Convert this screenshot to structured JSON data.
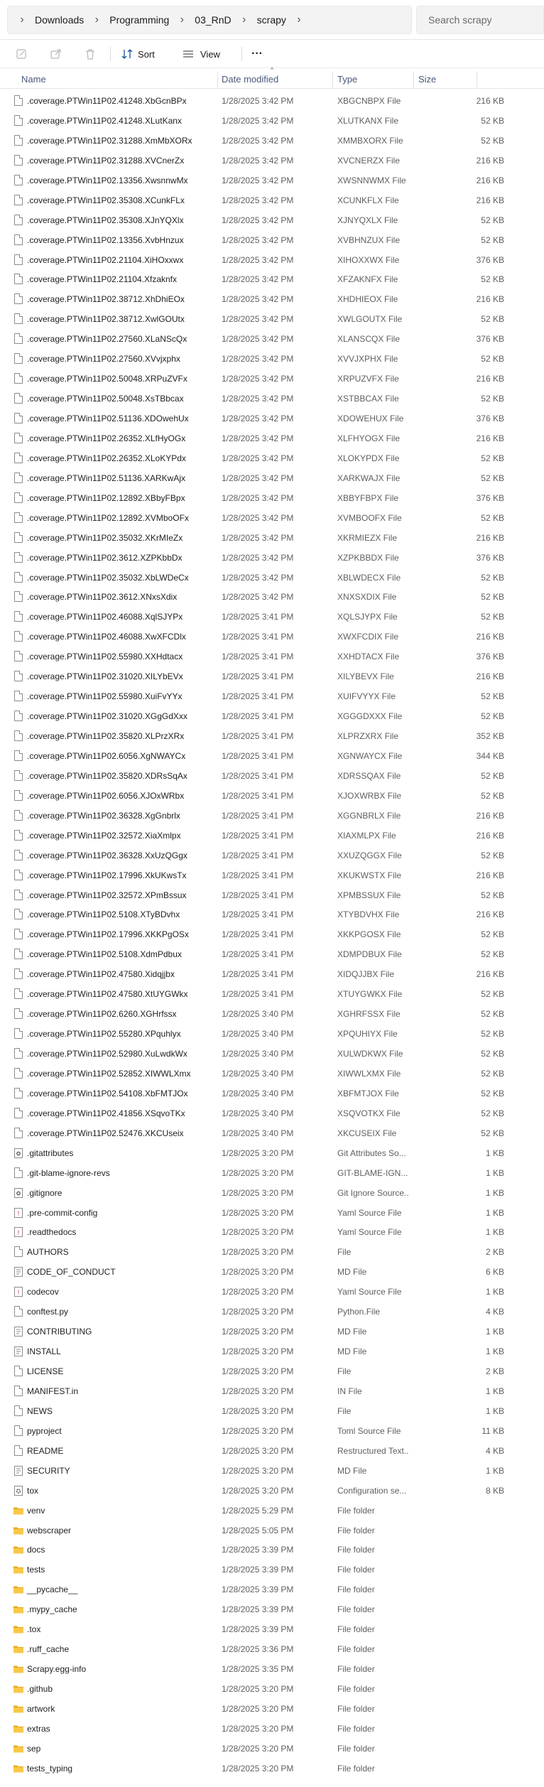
{
  "address": {
    "crumbs": [
      "Downloads",
      "Programming",
      "03_RnD",
      "scrapy"
    ],
    "search_placeholder": "Search scrapy"
  },
  "toolbar": {
    "sort_label": "Sort",
    "view_label": "View",
    "more_label": "···"
  },
  "columns": {
    "name": "Name",
    "date": "Date modified",
    "type": "Type",
    "size": "Size"
  },
  "files": [
    {
      "name": ".coverage.PTWin11P02.41248.XbGcnBPx",
      "date": "1/28/2025 3:42 PM",
      "type": "XBGCNBPX File",
      "size": "216 KB",
      "icon": "file"
    },
    {
      "name": ".coverage.PTWin11P02.41248.XLutKanx",
      "date": "1/28/2025 3:42 PM",
      "type": "XLUTKANX File",
      "size": "52 KB",
      "icon": "file"
    },
    {
      "name": ".coverage.PTWin11P02.31288.XmMbXORx",
      "date": "1/28/2025 3:42 PM",
      "type": "XMMBXORX File",
      "size": "52 KB",
      "icon": "file"
    },
    {
      "name": ".coverage.PTWin11P02.31288.XVCnerZx",
      "date": "1/28/2025 3:42 PM",
      "type": "XVCNERZX File",
      "size": "216 KB",
      "icon": "file"
    },
    {
      "name": ".coverage.PTWin11P02.13356.XwsnnwMx",
      "date": "1/28/2025 3:42 PM",
      "type": "XWSNNWMX File",
      "size": "216 KB",
      "icon": "file"
    },
    {
      "name": ".coverage.PTWin11P02.35308.XCunkFLx",
      "date": "1/28/2025 3:42 PM",
      "type": "XCUNKFLX File",
      "size": "216 KB",
      "icon": "file"
    },
    {
      "name": ".coverage.PTWin11P02.35308.XJnYQXlx",
      "date": "1/28/2025 3:42 PM",
      "type": "XJNYQXLX File",
      "size": "52 KB",
      "icon": "file"
    },
    {
      "name": ".coverage.PTWin11P02.13356.XvbHnzux",
      "date": "1/28/2025 3:42 PM",
      "type": "XVBHNZUX File",
      "size": "52 KB",
      "icon": "file"
    },
    {
      "name": ".coverage.PTWin11P02.21104.XiHOxxwx",
      "date": "1/28/2025 3:42 PM",
      "type": "XIHOXXWX File",
      "size": "376 KB",
      "icon": "file"
    },
    {
      "name": ".coverage.PTWin11P02.21104.Xfzaknfx",
      "date": "1/28/2025 3:42 PM",
      "type": "XFZAKNFX File",
      "size": "52 KB",
      "icon": "file"
    },
    {
      "name": ".coverage.PTWin11P02.38712.XhDhiEOx",
      "date": "1/28/2025 3:42 PM",
      "type": "XHDHIEOX File",
      "size": "216 KB",
      "icon": "file"
    },
    {
      "name": ".coverage.PTWin11P02.38712.XwlGOUtx",
      "date": "1/28/2025 3:42 PM",
      "type": "XWLGOUTX File",
      "size": "52 KB",
      "icon": "file"
    },
    {
      "name": ".coverage.PTWin11P02.27560.XLaNScQx",
      "date": "1/28/2025 3:42 PM",
      "type": "XLANSCQX File",
      "size": "376 KB",
      "icon": "file"
    },
    {
      "name": ".coverage.PTWin11P02.27560.XVvjxphx",
      "date": "1/28/2025 3:42 PM",
      "type": "XVVJXPHX File",
      "size": "52 KB",
      "icon": "file"
    },
    {
      "name": ".coverage.PTWin11P02.50048.XRPuZVFx",
      "date": "1/28/2025 3:42 PM",
      "type": "XRPUZVFX File",
      "size": "216 KB",
      "icon": "file"
    },
    {
      "name": ".coverage.PTWin11P02.50048.XsTBbcax",
      "date": "1/28/2025 3:42 PM",
      "type": "XSTBBCAX File",
      "size": "52 KB",
      "icon": "file"
    },
    {
      "name": ".coverage.PTWin11P02.51136.XDOwehUx",
      "date": "1/28/2025 3:42 PM",
      "type": "XDOWEHUX File",
      "size": "376 KB",
      "icon": "file"
    },
    {
      "name": ".coverage.PTWin11P02.26352.XLfHyOGx",
      "date": "1/28/2025 3:42 PM",
      "type": "XLFHYOGX File",
      "size": "216 KB",
      "icon": "file"
    },
    {
      "name": ".coverage.PTWin11P02.26352.XLoKYPdx",
      "date": "1/28/2025 3:42 PM",
      "type": "XLOKYPDX File",
      "size": "52 KB",
      "icon": "file"
    },
    {
      "name": ".coverage.PTWin11P02.51136.XARKwAjx",
      "date": "1/28/2025 3:42 PM",
      "type": "XARKWAJX File",
      "size": "52 KB",
      "icon": "file"
    },
    {
      "name": ".coverage.PTWin11P02.12892.XBbyFBpx",
      "date": "1/28/2025 3:42 PM",
      "type": "XBBYFBPX File",
      "size": "376 KB",
      "icon": "file"
    },
    {
      "name": ".coverage.PTWin11P02.12892.XVMboOFx",
      "date": "1/28/2025 3:42 PM",
      "type": "XVMBOOFX File",
      "size": "52 KB",
      "icon": "file"
    },
    {
      "name": ".coverage.PTWin11P02.35032.XKrMIeZx",
      "date": "1/28/2025 3:42 PM",
      "type": "XKRMIEZX File",
      "size": "216 KB",
      "icon": "file"
    },
    {
      "name": ".coverage.PTWin11P02.3612.XZPKbbDx",
      "date": "1/28/2025 3:42 PM",
      "type": "XZPKBBDX File",
      "size": "376 KB",
      "icon": "file"
    },
    {
      "name": ".coverage.PTWin11P02.35032.XbLWDeCx",
      "date": "1/28/2025 3:42 PM",
      "type": "XBLWDECX File",
      "size": "52 KB",
      "icon": "file"
    },
    {
      "name": ".coverage.PTWin11P02.3612.XNxsXdix",
      "date": "1/28/2025 3:42 PM",
      "type": "XNXSXDIX File",
      "size": "52 KB",
      "icon": "file"
    },
    {
      "name": ".coverage.PTWin11P02.46088.XqlSJYPx",
      "date": "1/28/2025 3:41 PM",
      "type": "XQLSJYPX File",
      "size": "52 KB",
      "icon": "file"
    },
    {
      "name": ".coverage.PTWin11P02.46088.XwXFCDlx",
      "date": "1/28/2025 3:41 PM",
      "type": "XWXFCDIX File",
      "size": "216 KB",
      "icon": "file"
    },
    {
      "name": ".coverage.PTWin11P02.55980.XXHdtacx",
      "date": "1/28/2025 3:41 PM",
      "type": "XXHDTACX File",
      "size": "376 KB",
      "icon": "file"
    },
    {
      "name": ".coverage.PTWin11P02.31020.XILYbEVx",
      "date": "1/28/2025 3:41 PM",
      "type": "XILYBEVX File",
      "size": "216 KB",
      "icon": "file"
    },
    {
      "name": ".coverage.PTWin11P02.55980.XuiFvYYx",
      "date": "1/28/2025 3:41 PM",
      "type": "XUIFVYYX File",
      "size": "52 KB",
      "icon": "file"
    },
    {
      "name": ".coverage.PTWin11P02.31020.XGgGdXxx",
      "date": "1/28/2025 3:41 PM",
      "type": "XGGGDXXX File",
      "size": "52 KB",
      "icon": "file"
    },
    {
      "name": ".coverage.PTWin11P02.35820.XLPrzXRx",
      "date": "1/28/2025 3:41 PM",
      "type": "XLPRZXRX File",
      "size": "352 KB",
      "icon": "file"
    },
    {
      "name": ".coverage.PTWin11P02.6056.XgNWAYCx",
      "date": "1/28/2025 3:41 PM",
      "type": "XGNWAYCX File",
      "size": "344 KB",
      "icon": "file"
    },
    {
      "name": ".coverage.PTWin11P02.35820.XDRsSqAx",
      "date": "1/28/2025 3:41 PM",
      "type": "XDRSSQAX File",
      "size": "52 KB",
      "icon": "file"
    },
    {
      "name": ".coverage.PTWin11P02.6056.XJOxWRbx",
      "date": "1/28/2025 3:41 PM",
      "type": "XJOXWRBX File",
      "size": "52 KB",
      "icon": "file"
    },
    {
      "name": ".coverage.PTWin11P02.36328.XgGnbrlx",
      "date": "1/28/2025 3:41 PM",
      "type": "XGGNBRLX File",
      "size": "216 KB",
      "icon": "file"
    },
    {
      "name": ".coverage.PTWin11P02.32572.XiaXmlpx",
      "date": "1/28/2025 3:41 PM",
      "type": "XIAXMLPX File",
      "size": "216 KB",
      "icon": "file"
    },
    {
      "name": ".coverage.PTWin11P02.36328.XxUzQGgx",
      "date": "1/28/2025 3:41 PM",
      "type": "XXUZQGGX File",
      "size": "52 KB",
      "icon": "file"
    },
    {
      "name": ".coverage.PTWin11P02.17996.XkUKwsTx",
      "date": "1/28/2025 3:41 PM",
      "type": "XKUKWSTX File",
      "size": "216 KB",
      "icon": "file"
    },
    {
      "name": ".coverage.PTWin11P02.32572.XPmBssux",
      "date": "1/28/2025 3:41 PM",
      "type": "XPMBSSUX File",
      "size": "52 KB",
      "icon": "file"
    },
    {
      "name": ".coverage.PTWin11P02.5108.XTyBDvhx",
      "date": "1/28/2025 3:41 PM",
      "type": "XTYBDVHX File",
      "size": "216 KB",
      "icon": "file"
    },
    {
      "name": ".coverage.PTWin11P02.17996.XKKPgOSx",
      "date": "1/28/2025 3:41 PM",
      "type": "XKKPGOSX File",
      "size": "52 KB",
      "icon": "file"
    },
    {
      "name": ".coverage.PTWin11P02.5108.XdmPdbux",
      "date": "1/28/2025 3:41 PM",
      "type": "XDMPDBUX File",
      "size": "52 KB",
      "icon": "file"
    },
    {
      "name": ".coverage.PTWin11P02.47580.Xidqjjbx",
      "date": "1/28/2025 3:41 PM",
      "type": "XIDQJJBX File",
      "size": "216 KB",
      "icon": "file"
    },
    {
      "name": ".coverage.PTWin11P02.47580.XtUYGWkx",
      "date": "1/28/2025 3:41 PM",
      "type": "XTUYGWKX File",
      "size": "52 KB",
      "icon": "file"
    },
    {
      "name": ".coverage.PTWin11P02.6260.XGHrfssx",
      "date": "1/28/2025 3:40 PM",
      "type": "XGHRFSSX File",
      "size": "52 KB",
      "icon": "file"
    },
    {
      "name": ".coverage.PTWin11P02.55280.XPquhlyx",
      "date": "1/28/2025 3:40 PM",
      "type": "XPQUHIYX File",
      "size": "52 KB",
      "icon": "file"
    },
    {
      "name": ".coverage.PTWin11P02.52980.XuLwdkWx",
      "date": "1/28/2025 3:40 PM",
      "type": "XULWDKWX File",
      "size": "52 KB",
      "icon": "file"
    },
    {
      "name": ".coverage.PTWin11P02.52852.XIWWLXmx",
      "date": "1/28/2025 3:40 PM",
      "type": "XIWWLXMX File",
      "size": "52 KB",
      "icon": "file"
    },
    {
      "name": ".coverage.PTWin11P02.54108.XbFMTJOx",
      "date": "1/28/2025 3:40 PM",
      "type": "XBFMTJOX File",
      "size": "52 KB",
      "icon": "file"
    },
    {
      "name": ".coverage.PTWin11P02.41856.XSqvoTKx",
      "date": "1/28/2025 3:40 PM",
      "type": "XSQVOTKX File",
      "size": "52 KB",
      "icon": "file"
    },
    {
      "name": ".coverage.PTWin11P02.52476.XKCUseix",
      "date": "1/28/2025 3:40 PM",
      "type": "XKCUSEIX File",
      "size": "52 KB",
      "icon": "file"
    },
    {
      "name": ".gitattributes",
      "date": "1/28/2025 3:20 PM",
      "type": "Git Attributes So...",
      "size": "1 KB",
      "icon": "git"
    },
    {
      "name": ".git-blame-ignore-revs",
      "date": "1/28/2025 3:20 PM",
      "type": "GIT-BLAME-IGN...",
      "size": "1 KB",
      "icon": "file"
    },
    {
      "name": ".gitignore",
      "date": "1/28/2025 3:20 PM",
      "type": "Git Ignore Source...",
      "size": "1 KB",
      "icon": "git"
    },
    {
      "name": ".pre-commit-config",
      "date": "1/28/2025 3:20 PM",
      "type": "Yaml Source File",
      "size": "1 KB",
      "icon": "yaml"
    },
    {
      "name": ".readthedocs",
      "date": "1/28/2025 3:20 PM",
      "type": "Yaml Source File",
      "size": "1 KB",
      "icon": "yaml"
    },
    {
      "name": "AUTHORS",
      "date": "1/28/2025 3:20 PM",
      "type": "File",
      "size": "2 KB",
      "icon": "file"
    },
    {
      "name": "CODE_OF_CONDUCT",
      "date": "1/28/2025 3:20 PM",
      "type": "MD File",
      "size": "6 KB",
      "icon": "text"
    },
    {
      "name": "codecov",
      "date": "1/28/2025 3:20 PM",
      "type": "Yaml Source File",
      "size": "1 KB",
      "icon": "yaml"
    },
    {
      "name": "conftest.py",
      "date": "1/28/2025 3:20 PM",
      "type": "Python.File",
      "size": "4 KB",
      "icon": "file"
    },
    {
      "name": "CONTRIBUTING",
      "date": "1/28/2025 3:20 PM",
      "type": "MD File",
      "size": "1 KB",
      "icon": "text"
    },
    {
      "name": "INSTALL",
      "date": "1/28/2025 3:20 PM",
      "type": "MD File",
      "size": "1 KB",
      "icon": "text"
    },
    {
      "name": "LICENSE",
      "date": "1/28/2025 3:20 PM",
      "type": "File",
      "size": "2 KB",
      "icon": "file"
    },
    {
      "name": "MANIFEST.in",
      "date": "1/28/2025 3:20 PM",
      "type": "IN File",
      "size": "1 KB",
      "icon": "file"
    },
    {
      "name": "NEWS",
      "date": "1/28/2025 3:20 PM",
      "type": "File",
      "size": "1 KB",
      "icon": "file"
    },
    {
      "name": "pyproject",
      "date": "1/28/2025 3:20 PM",
      "type": "Toml Source File",
      "size": "11 KB",
      "icon": "file"
    },
    {
      "name": "README",
      "date": "1/28/2025 3:20 PM",
      "type": "Restructured Text...",
      "size": "4 KB",
      "icon": "file"
    },
    {
      "name": "SECURITY",
      "date": "1/28/2025 3:20 PM",
      "type": "MD File",
      "size": "1 KB",
      "icon": "text"
    },
    {
      "name": "tox",
      "date": "1/28/2025 3:20 PM",
      "type": "Configuration se...",
      "size": "8 KB",
      "icon": "config"
    },
    {
      "name": "venv",
      "date": "1/28/2025 5:29 PM",
      "type": "File folder",
      "size": "",
      "icon": "folder"
    },
    {
      "name": "webscraper",
      "date": "1/28/2025 5:05 PM",
      "type": "File folder",
      "size": "",
      "icon": "folder"
    },
    {
      "name": "docs",
      "date": "1/28/2025 3:39 PM",
      "type": "File folder",
      "size": "",
      "icon": "folder"
    },
    {
      "name": "tests",
      "date": "1/28/2025 3:39 PM",
      "type": "File folder",
      "size": "",
      "icon": "folder"
    },
    {
      "name": "__pycache__",
      "date": "1/28/2025 3:39 PM",
      "type": "File folder",
      "size": "",
      "icon": "folder"
    },
    {
      "name": ".mypy_cache",
      "date": "1/28/2025 3:39 PM",
      "type": "File folder",
      "size": "",
      "icon": "folder"
    },
    {
      "name": ".tox",
      "date": "1/28/2025 3:39 PM",
      "type": "File folder",
      "size": "",
      "icon": "folder"
    },
    {
      "name": ".ruff_cache",
      "date": "1/28/2025 3:36 PM",
      "type": "File folder",
      "size": "",
      "icon": "folder"
    },
    {
      "name": "Scrapy.egg-info",
      "date": "1/28/2025 3:35 PM",
      "type": "File folder",
      "size": "",
      "icon": "folder"
    },
    {
      "name": ".github",
      "date": "1/28/2025 3:20 PM",
      "type": "File folder",
      "size": "",
      "icon": "folder"
    },
    {
      "name": "artwork",
      "date": "1/28/2025 3:20 PM",
      "type": "File folder",
      "size": "",
      "icon": "folder"
    },
    {
      "name": "extras",
      "date": "1/28/2025 3:20 PM",
      "type": "File folder",
      "size": "",
      "icon": "folder"
    },
    {
      "name": "sep",
      "date": "1/28/2025 3:20 PM",
      "type": "File folder",
      "size": "",
      "icon": "folder"
    },
    {
      "name": "tests_typing",
      "date": "1/28/2025 3:20 PM",
      "type": "File folder",
      "size": "",
      "icon": "folder"
    }
  ]
}
